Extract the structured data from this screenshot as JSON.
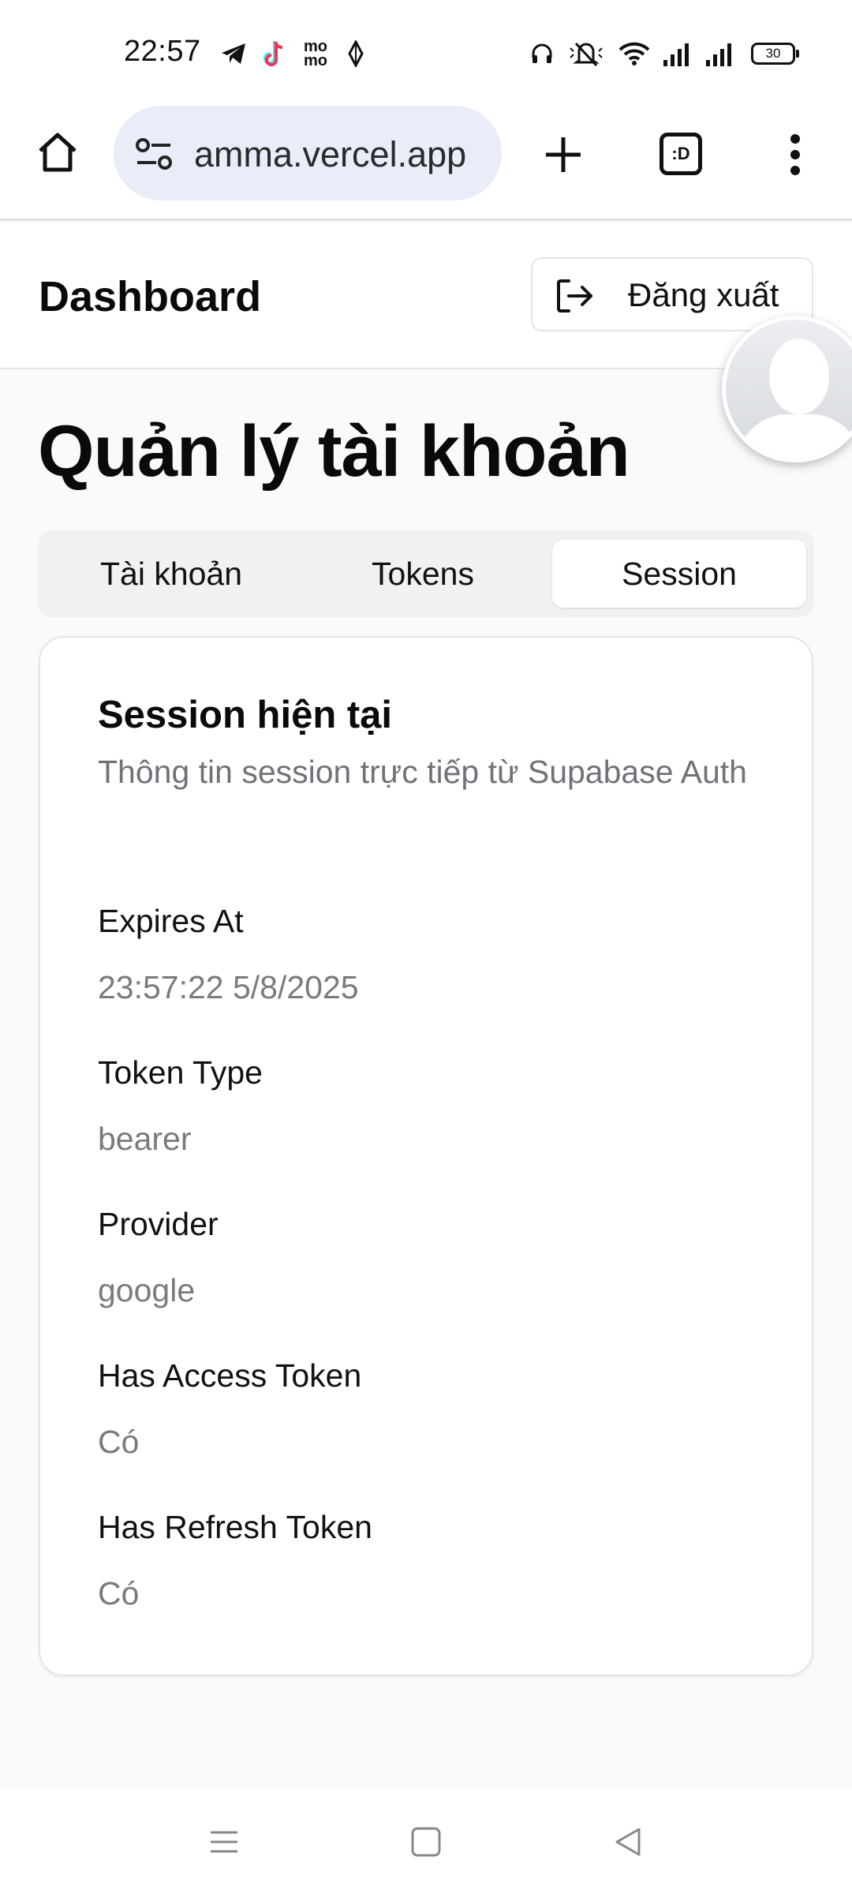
{
  "status_bar": {
    "time": "22:57",
    "app_icons": [
      "telegram-icon",
      "tiktok-icon",
      "momo-icon",
      "diamond-icon"
    ],
    "momo_text": "mo\nmo",
    "system_icons": [
      "headphones-icon",
      "silent-icon",
      "wifi-icon",
      "signal-icon",
      "signal-icon"
    ],
    "battery": "30"
  },
  "browser": {
    "url": "amma.vercel.app",
    "tab_count": ":D",
    "icons": [
      "home-icon",
      "site-settings-icon",
      "new-tab-icon",
      "tabs-icon",
      "menu-icon"
    ]
  },
  "header": {
    "title": "Dashboard",
    "logout_label": "Đăng xuất"
  },
  "main": {
    "heading": "Quản lý tài khoản",
    "tabs": [
      {
        "label": "Tài khoản",
        "active": false
      },
      {
        "label": "Tokens",
        "active": false
      },
      {
        "label": "Session",
        "active": true
      }
    ],
    "card": {
      "title": "Session hiện tại",
      "description": "Thông tin session trực tiếp từ Supabase Auth",
      "fields": [
        {
          "label": "Expires At",
          "value": "23:57:22 5/8/2025"
        },
        {
          "label": "Token Type",
          "value": "bearer"
        },
        {
          "label": "Provider",
          "value": "google"
        },
        {
          "label": "Has Access Token",
          "value": "Có"
        },
        {
          "label": "Has Refresh Token",
          "value": "Có"
        }
      ]
    }
  },
  "nav_bar": {
    "icons": [
      "recent-apps-icon",
      "home-button-icon",
      "back-icon"
    ]
  }
}
